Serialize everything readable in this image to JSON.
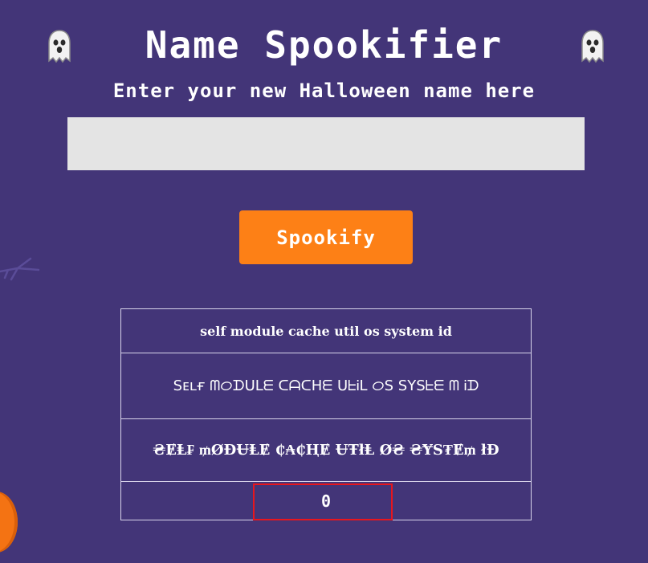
{
  "header": {
    "title": "Name Spookifier",
    "ghost_icon": "ghost-icon",
    "subtitle": "Enter your new Halloween name here"
  },
  "form": {
    "name_input": {
      "value": "",
      "placeholder": ""
    },
    "submit_label": "Spookify"
  },
  "results": {
    "rows": [
      "self module cache util os system id",
      "Sᴇʟғ ᗰᝪᗪᑌᒪᗴ ᑕᗩᑕᕼᗴ ᑌᖶᎥᒪ ᝪS SYSᖶᗴ ᗰ Ꭵᗪ",
      "₴ɆⱠ₣ ₥ØĐɄⱠɆ ₵₳₵ⱧɆ ɄŦłⱠ Ø₴ ₴ɎS₮Ɇ₥ łĐ",
      "0"
    ]
  },
  "colors": {
    "background": "#433578",
    "button": "#fd8016",
    "input": "#e4e4e4",
    "highlight": "#e8161d"
  }
}
